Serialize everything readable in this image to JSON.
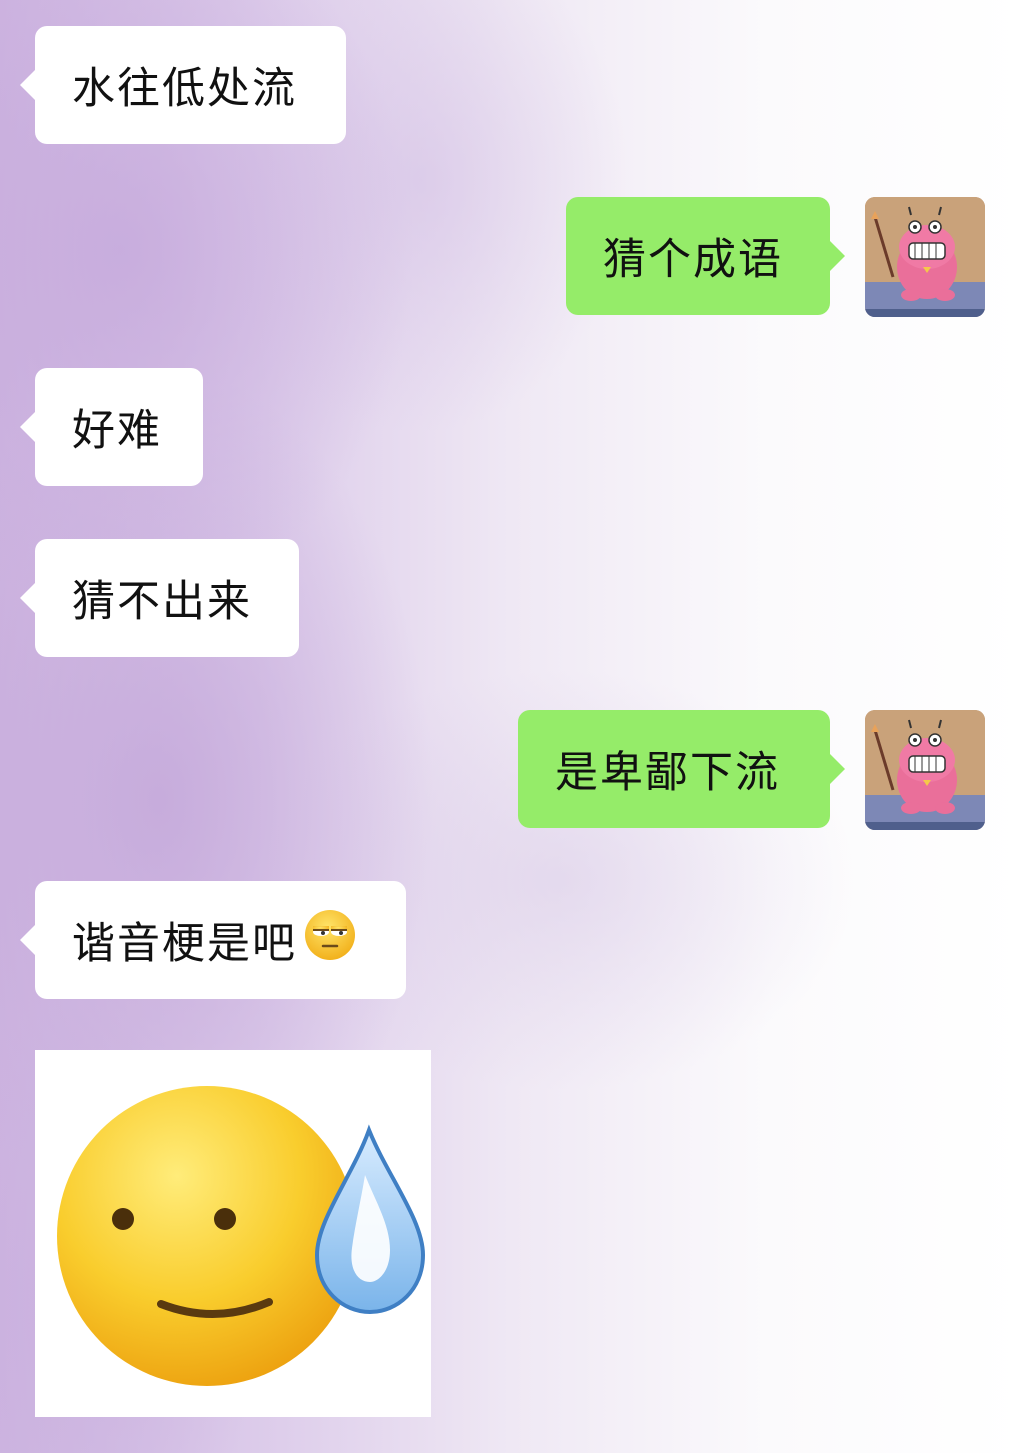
{
  "chat": {
    "messages": [
      {
        "side": "left",
        "text": "水往低处流"
      },
      {
        "side": "right",
        "text": "猜个成语"
      },
      {
        "side": "left",
        "text": "好难"
      },
      {
        "side": "left",
        "text": "猜不出来"
      },
      {
        "side": "right",
        "text": "是卑鄙下流"
      },
      {
        "side": "left",
        "text": "谐音梗是吧",
        "emoji": "unamused-face"
      },
      {
        "side": "left",
        "sticker": "sweat-smile-face"
      }
    ],
    "avatar_icon": "pink-dinosaur-cartoon-icon"
  },
  "colors": {
    "received_bubble": "#ffffff",
    "sent_bubble": "#95ec69",
    "text": "#111111",
    "background_accent": "#cdb4e0"
  }
}
